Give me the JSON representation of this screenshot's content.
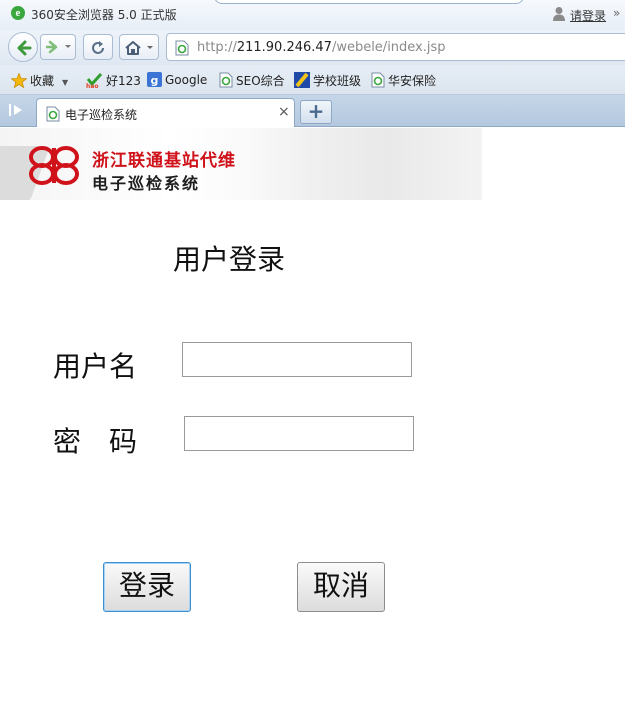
{
  "browser": {
    "title": "360安全浏览器 5.0 正式版",
    "login_link": "请登录",
    "more": "»",
    "url": {
      "scheme": "http://",
      "host": "211.90.246.47",
      "path": "/webele/index.jsp"
    }
  },
  "favorites": {
    "items": [
      {
        "label": "收藏"
      },
      {
        "label": "好123"
      },
      {
        "label": "Google"
      },
      {
        "label": "SEO综合"
      },
      {
        "label": "学校班级"
      },
      {
        "label": "华安保险"
      }
    ]
  },
  "tabs": {
    "items": [
      {
        "title": "电子巡检系统",
        "active": true
      }
    ],
    "close": "×",
    "new_tab": "+"
  },
  "banner": {
    "line1": "浙江联通基站代维",
    "line2": "电子巡检系统"
  },
  "login": {
    "heading": "用户登录",
    "username_label": "用户名",
    "password_label": "密　码",
    "username_value": "",
    "password_value": "",
    "login_button": "登录",
    "cancel_button": "取消"
  },
  "colors": {
    "brand_red": "#d0121b",
    "focus_blue": "#3c8fd0",
    "chrome_blue": "#b4c8de"
  }
}
